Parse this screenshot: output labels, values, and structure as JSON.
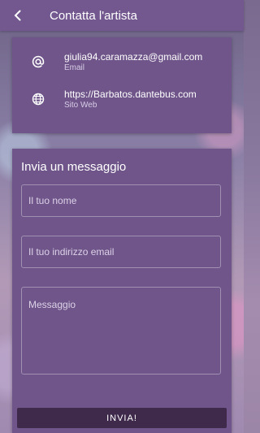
{
  "appbar": {
    "title": "Contatta l'artista",
    "back_icon": "arrow-left-icon"
  },
  "contact": {
    "email": {
      "value": "giulia94.caramazza@gmail.com",
      "label": "Email",
      "icon": "at-icon"
    },
    "website": {
      "value": "https://Barbatos.dantebus.com",
      "label": "Sito Web",
      "icon": "globe-icon"
    }
  },
  "form": {
    "title": "Invia un messaggio",
    "name_placeholder": "Il tuo nome",
    "email_placeholder": "Il tuo indirizzo email",
    "message_placeholder": "Messaggio",
    "send_label": "INVIA!"
  },
  "colors": {
    "appbar": "#73588f",
    "card": "#6f5589",
    "button": "#3f2a4c"
  }
}
